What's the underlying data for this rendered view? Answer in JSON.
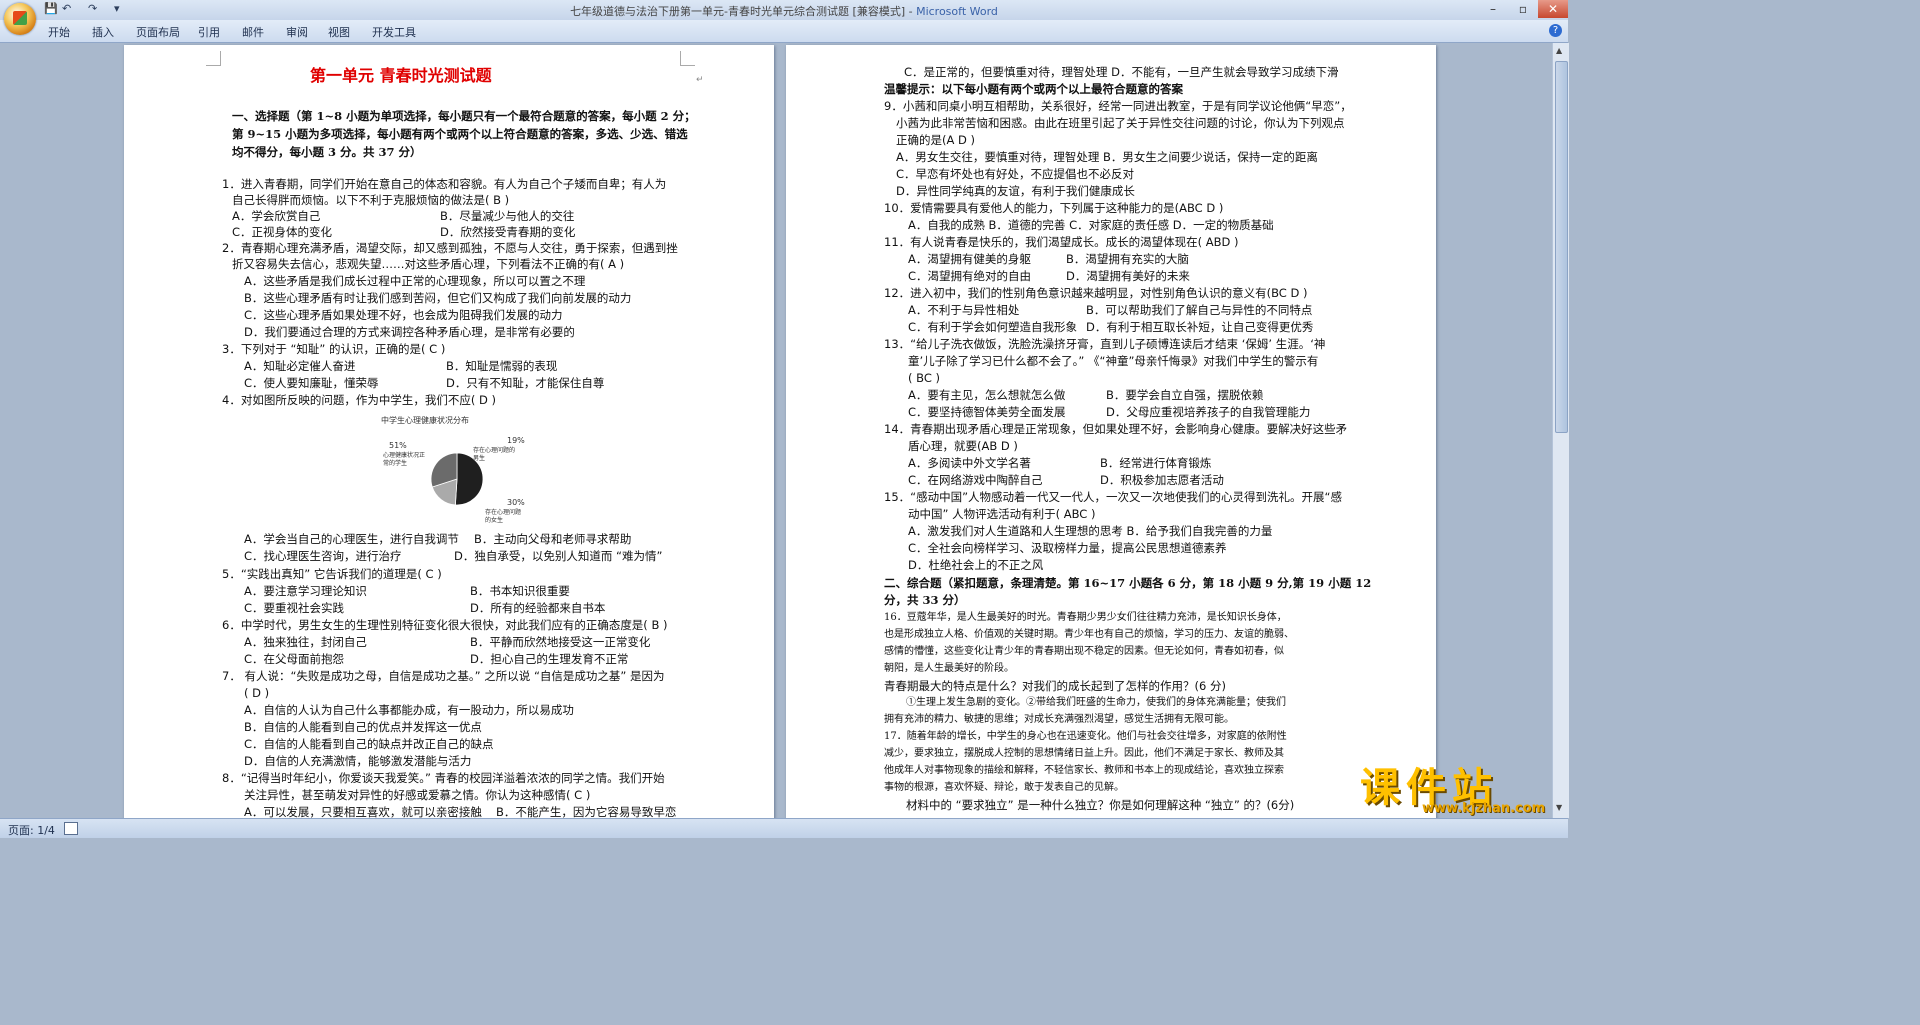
{
  "window": {
    "title": "七年级道德与法治下册第一单元-青春时光单元综合测试题 [兼容模式] - ",
    "app": "Microsoft Word",
    "quick_access": [
      "💾",
      "↶",
      "↷",
      "▾"
    ],
    "controls": {
      "minimize": "–",
      "maximize": "▫",
      "close": "✕"
    }
  },
  "ribbon": {
    "tabs": [
      "开始",
      "插入",
      "页面布局",
      "引用",
      "邮件",
      "审阅",
      "视图",
      "开发工具"
    ],
    "help": "?"
  },
  "status": {
    "page": "页面: 1/4"
  },
  "watermark": {
    "main": "课件站",
    "url": "www.kjzhan.com"
  },
  "left_page": {
    "title": "第一单元   青春时光测试题",
    "lines": [
      "一、选择题（第 1~8 小题为单项选择，每小题只有一个最符合题意的答案，每小题 2 分；",
      "第 9~15 小题为多项选择，每小题有两个或两个以上符合题意的答案，多选、少选、错选",
      "均不得分，每小题 3 分。共 37 分）",
      "1．进入青春期，同学们开始在意自己的体态和容貌。有人为自己个子矮而自卑；有人为",
      "自己长得胖而烦恼。以下不利于克服烦恼的做法是(   B   )",
      "A．学会欣赏自己",
      "B．尽量减少与他人的交往",
      "C．正视身体的变化",
      "D．欣然接受青春期的变化",
      "2．青春期心理充满矛盾，渴望交际，却又感到孤独，不愿与人交往，勇于探索，但遇到挫",
      "折又容易失去信心，悲观失望……对这些矛盾心理，下列看法不正确的有(    A    )",
      "A．这些矛盾是我们成长过程中正常的心理现象，所以可以置之不理",
      "B．这些心理矛盾有时让我们感到苦闷，但它们又构成了我们向前发展的动力",
      "C．这些心理矛盾如果处理不好，也会成为阻碍我们发展的动力",
      "D．我们要通过合理的方式来调控各种矛盾心理，是非常有必要的",
      "3．下列对于 “知耻” 的认识，正确的是(   C     )",
      "A．知耻必定催人奋进",
      "B．知耻是懦弱的表现",
      "C．使人要知廉耻，懂荣辱",
      "D．只有不知耻，才能保住自尊",
      "4．对如图所反映的问题，作为中学生，我们不应(    D    )",
      "A．学会当自己的心理医生，进行自我调节",
      "B．主动向父母和老师寻求帮助",
      "C．找心理医生咨询，进行治疗",
      "D．独自承受，以免别人知道而 “难为情”",
      "5．“实践出真知” 它告诉我们的道理是(    C    )",
      "A．要注意学习理论知识",
      "B．书本知识很重要",
      "C．要重视社会实践",
      "D．所有的经验都来自书本",
      "6．中学时代，男生女生的生理性别特征变化很大很快，对此我们应有的正确态度是(    B    )",
      "A．独来独往，封闭自己",
      "B．平静而欣然地接受这一正常变化",
      "C．在父母面前抱怨",
      "D．担心自己的生理发育不正常",
      "7． 有人说：“失败是成功之母，自信是成功之基。” 之所以说 “自信是成功之基” 是因为",
      "(   D   )",
      "A．自信的人认为自己什么事都能办成，有一股动力，所以易成功",
      "B．自信的人能看到自己的优点并发挥这一优点",
      "C．自信的人能看到自己的缺点并改正自己的缺点",
      "D．自信的人充满激情，能够激发潜能与活力",
      "8．“记得当时年纪小，你爱谈天我爱笑。” 青春的校园洋溢着浓浓的同学之情。我们开始",
      "关注异性，甚至萌发对异性的好感或爱慕之情。你认为这种感情(    C    )",
      "A．可以发展，只要相互喜欢，就可以亲密接触",
      "B．不能产生，因为它容易导致早恋"
    ]
  },
  "right_page": {
    "lines": [
      "C．是正常的，但要慎重对待，理智处理  D．不能有，一旦产生就会导致学习成绩下滑",
      "温馨提示：以下每小题有两个或两个以上最符合题意的答案",
      "9．小茜和同桌小明互相帮助，关系很好，经常一同进出教室，于是有同学议论他俩“早恋”，",
      "小茜为此非常苦恼和困惑。由此在班里引起了关于异性交往问题的讨论，你认为下列观点",
      "正确的是(A    D    )",
      "A．男女生交往，要慎重对待，理智处理   B．男女生之间要少说话，保持一定的距离",
      "C．早恋有坏处也有好处，不应提倡也不必反对",
      "D．异性同学纯真的友谊，有利于我们健康成长",
      "10．爱情需要具有爱他人的能力，下列属于这种能力的是(ABC   D    )",
      "A．自我的成熟  B．道德的完善  C．对家庭的责任感   D．一定的物质基础",
      "11．有人说青春是快乐的，我们渴望成长。成长的渴望体现在(   ABD    )",
      "A．渴望拥有健美的身躯",
      "B．渴望拥有充实的大脑",
      "C．渴望拥有绝对的自由",
      "D．渴望拥有美好的未来",
      "12．进入初中，我们的性别角色意识越来越明显，对性别角色认识的意义有(BC   D    )",
      "A．不利于与异性相处",
      "B．可以帮助我们了解自己与异性的不同特点",
      "C．有利于学会如何塑造自我形象",
      "D．有利于相互取长补短，让自己变得更优秀",
      "13．“给儿子洗衣做饭，洗脸洗澡挤牙膏，直到儿子硕博连读后才结束 ‘保姆’ 生涯。‘神",
      "童’儿子除了学习已什么都不会了。” 《“神童”母亲忏悔录》对我们中学生的警示有",
      "(    BC    )",
      "A．要有主见，怎么想就怎么做",
      "B．要学会自立自强，摆脱依赖",
      "C．要坚持德智体美劳全面发展",
      "D．父母应重视培养孩子的自我管理能力",
      "14．青春期出现矛盾心理是正常现象，但如果处理不好，会影响身心健康。要解决好这些矛",
      "盾心理，就要(AB    D    )",
      "A．多阅读中外文学名著",
      "B．经常进行体育锻炼",
      "C．在网络游戏中陶醉自己",
      "D．积极参加志愿者活动",
      "15．“感动中国”人物感动着一代又一代人，一次又一次地使我们的心灵得到洗礼。开展“感",
      "动中国” 人物评选活动有利于(    ABC    )",
      "A．激发我们对人生道路和人生理想的思考   B．给予我们自我完善的力量",
      "C．全社会向榜样学习、汲取榜样力量，提高公民思想道德素养",
      "D．杜绝社会上的不正之风",
      "二、综合题（紧扣题意，条理清楚。第 16~17 小题各 6 分，第 18 小题 9 分,第 19 小题 12",
      "分，共 33 分）",
      "16．豆蔻年华，是人生最美好的时光。青春期少男少女们往往精力充沛，是长知识长身体，",
      "也是形成独立人格、价值观的关键时期。青少年也有自己的烦恼，学习的压力、友谊的脆弱、",
      "感情的懵懂，这些变化让青少年的青春期出现不稳定的因素。但无论如何，青春如初春，似",
      "朝阳，是人生最美好的阶段。",
      "青春期最大的特点是什么？对我们的成长起到了怎样的作用？(6 分)",
      "①生理上发生急剧的变化。②带给我们旺盛的生命力，使我们的身体充满能量；使我们",
      "拥有充沛的精力、敏捷的思维；对成长充满强烈渴望，感觉生活拥有无限可能。",
      "17．随着年龄的增长，中学生的身心也在迅速变化。他们与社会交往增多，对家庭的依附性",
      "减少，要求独立，摆脱成人控制的思想情绪日益上升。因此，他们不满足于家长、教师及其",
      "他成年人对事物现象的描绘和解释，不轻信家长、教师和书本上的现成结论，喜欢独立探索",
      "事物的根源，喜欢怀疑、辩论，敢于发表自己的见解。",
      "材料中的 “要求独立” 是一种什么独立？你是如何理解这种 “独立” 的？(6分)"
    ]
  },
  "chart_data": {
    "type": "pie",
    "title": "中学生心理健康状况分布",
    "slices": [
      {
        "label": "心理健康状况正常的学生",
        "value": 51,
        "display": "51%",
        "color": "#1f1f1f"
      },
      {
        "label": "存在心理问题的男生",
        "value": 19,
        "display": "19%",
        "color": "#aaaaaa"
      },
      {
        "label": "存在心理问题的女生",
        "value": 30,
        "display": "30%",
        "color": "#6b6b6b"
      }
    ]
  }
}
